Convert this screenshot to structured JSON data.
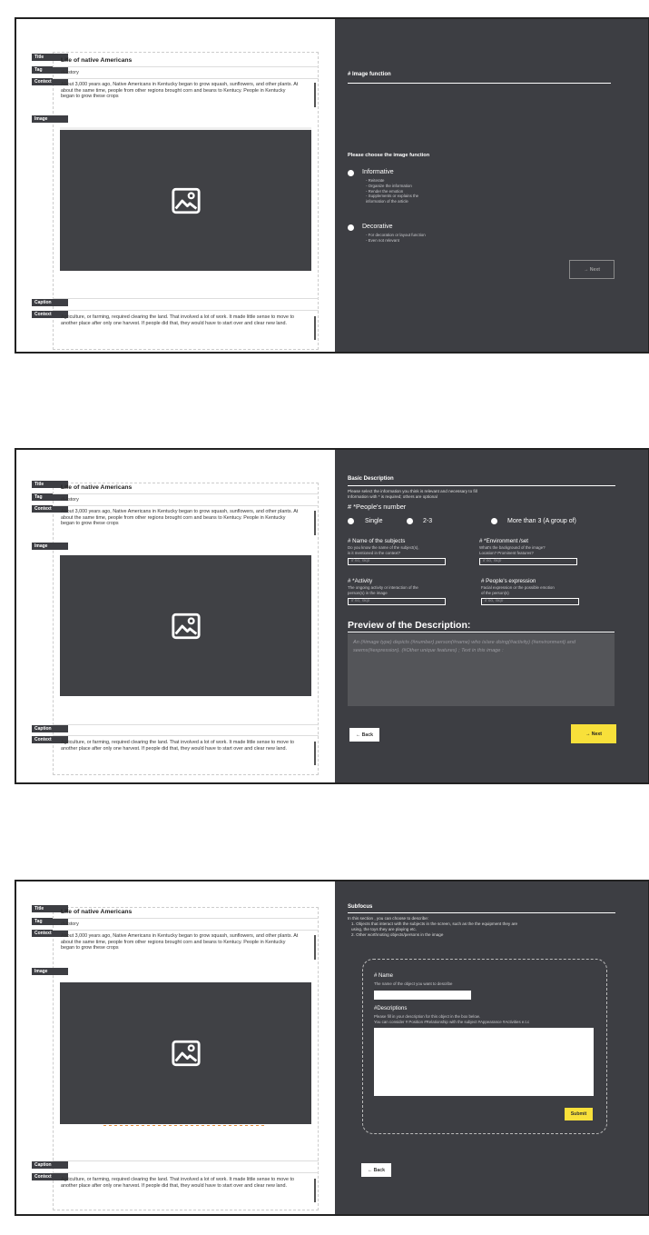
{
  "article": {
    "title_tag": "Title",
    "tag_tag": "Tag",
    "context_tag": "Context",
    "image_tag": "Image",
    "caption_tag": "Caption",
    "title": "Life of native Americans",
    "tag": "#History",
    "context1_s1": "About 3,000 years ago, Native Americans in  Kentucky began to grow squash, sunflowers, and other plants. At about the same time, people from other regions brought corn and beans to Kentucy. People in Kentucky began to grow these crops",
    "context1_s2": "About 3,000 years ago, Native Americans in  Kentucky began to grow squash, sunflowers, and other plants. At about the same time, people from other regions brought corn and beans to Kentucy. People in Kentucky began to grow these crops",
    "context2": "Agriculture, or farming, required clearing the land. That involved a lot of work. It made little sense to move to another place after only one harvest. If people did that, they would have to start over and clear new land."
  },
  "screen1": {
    "heading": "# Image function",
    "question": "Please choose the image function",
    "option1": "Informative",
    "option1_points": [
      "- Reiterate",
      "- Organize the information",
      "- Render the emotion",
      "- Supplements or explains the",
      "  information of the article"
    ],
    "option2": "Decorative",
    "option2_points": [
      "- For decoration or layout function",
      "- Even not relevant"
    ],
    "next": "→  Next"
  },
  "screen2": {
    "heading": "Basic Description",
    "intro1": "Please select the information you think is relevant and necessary to fill",
    "intro2": "Information with * is required; others are optional",
    "number_label": "# *People's number",
    "opt_single": "Single",
    "opt_23": "2-3",
    "opt_more": "More than 3 (A group of)",
    "name_label": "# Name of the subjects",
    "name_hint1": "Do you know the name of the subject(s),",
    "name_hint2": "is it mentioned in the context?",
    "env_label": "# *Environment /set",
    "env_hint1": "What's the background of the image?",
    "env_hint2": "Location? Prominent features?",
    "activity_label": "# *Activity",
    "activity_hint1": "The ongoing activity or interaction of the",
    "activity_hint2": "person(s) in the image",
    "expr_label": "# People's expression",
    "expr_hint1": "Facial expression or  the possible emotion",
    "expr_hint2": "of the person(s)",
    "placeholder": "if no, skip",
    "preview_heading": "Preview of the Description:",
    "preview_text": "An (#image type) depicts (#number) person(#name) who is/are doing(#activity) (#environment) and seems(#expression). (#Other unique features) ; Text in this image :",
    "back": "← Back",
    "next": "→  Next"
  },
  "screen3": {
    "heading": "Subfocus",
    "intro": "In this section , you can choose to describe:",
    "item1a": "1. Objects that interact with the subjects in the screen, such as the the equipment they are",
    "item1b": "    using, the toys they are playing etc.",
    "item2": "2. Other worthnoting objects/persons in the image",
    "name_label": "# Name",
    "name_hint": "The name of the object you want to describe",
    "desc_label": "#Descriptions",
    "desc_hint1": "Please fill in your description for this object in the box below.",
    "desc_hint2": "You can consider # Position #Relationship with the subject #Appearance #Activities e.t.c",
    "submit": "Submit",
    "back": "← Back"
  },
  "icons": {
    "image": "image-placeholder-icon"
  },
  "colors": {
    "panel": "#3d3e43",
    "accent": "#f8e03a"
  }
}
